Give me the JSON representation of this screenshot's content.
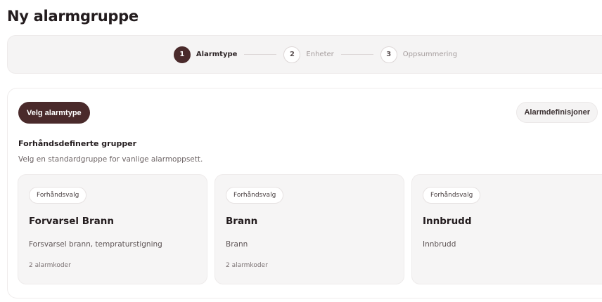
{
  "page": {
    "title": "Ny alarmgruppe"
  },
  "stepper": {
    "steps": [
      {
        "number": "1",
        "label": "Alarmtype",
        "active": true
      },
      {
        "number": "2",
        "label": "Enheter",
        "active": false
      },
      {
        "number": "3",
        "label": "Oppsummering",
        "active": false
      }
    ]
  },
  "actions": {
    "select_type_label": "Velg alarmtype",
    "definitions_label": "Alarmdefinisjoner"
  },
  "section": {
    "title": "Forhåndsdefinerte grupper",
    "description": "Velg en standardgruppe for vanlige alarmoppsett."
  },
  "groups": [
    {
      "badge": "Forhåndsvalg",
      "title": "Forvarsel Brann",
      "description": "Forsvarsel brann, tempraturstigning",
      "meta": "2 alarmkoder"
    },
    {
      "badge": "Forhåndsvalg",
      "title": "Brann",
      "description": "Brann",
      "meta": "2 alarmkoder"
    },
    {
      "badge": "Forhåndsvalg",
      "title": "Innbrudd",
      "description": "Innbrudd",
      "meta": ""
    }
  ],
  "colors": {
    "accent": "#4a2a2b",
    "panel": "#f5f4f4"
  }
}
